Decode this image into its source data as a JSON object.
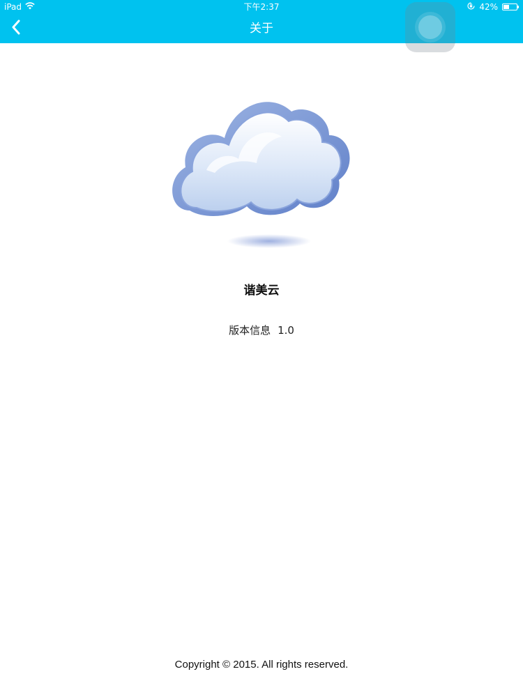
{
  "status_bar": {
    "device": "iPad",
    "time": "下午2:37",
    "battery": "42%",
    "battery_level": 0.42,
    "icons": [
      "wifi-icon",
      "rotation-lock-icon",
      "battery-icon"
    ]
  },
  "nav": {
    "title": "关于",
    "back_icon": "chevron-left-icon"
  },
  "colors": {
    "header": "#00c2ef",
    "background": "#ffffff"
  },
  "app": {
    "name": "谐美云",
    "version_label": "版本信息",
    "version": "1.0",
    "logo_icon": "cloud-icon"
  },
  "footer": {
    "copyright": "Copyright © 2015. All rights reserved."
  }
}
